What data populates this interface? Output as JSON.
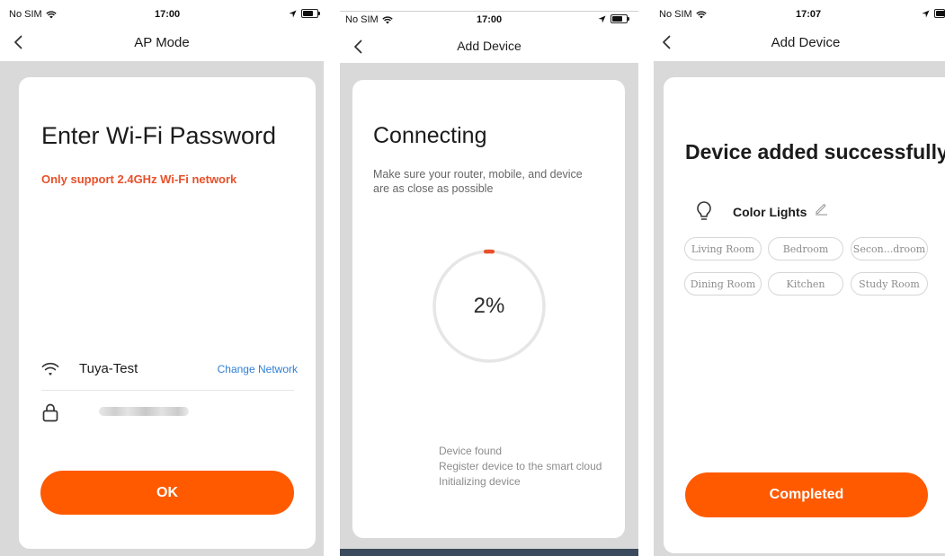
{
  "colors": {
    "accent": "#ff5a00",
    "warning_text": "#e8502a",
    "link": "#2e7fd6",
    "backdrop": "#d9d9d9"
  },
  "screen_ap_mode": {
    "status": {
      "carrier": "No SIM",
      "time": "17:00"
    },
    "nav": {
      "title": "AP Mode",
      "back_icon": "chevron-left-icon"
    },
    "heading": "Enter Wi-Fi Password",
    "warning": "Only support 2.4GHz Wi-Fi network",
    "wifi": {
      "icon": "wifi-icon",
      "ssid": "Tuya-Test",
      "change_label": "Change Network"
    },
    "password": {
      "icon": "lock-icon",
      "value": ""
    },
    "ok_label": "OK"
  },
  "screen_connecting": {
    "status": {
      "carrier": "No SIM",
      "time": "17:00"
    },
    "nav": {
      "title": "Add Device",
      "back_icon": "chevron-left-icon"
    },
    "heading": "Connecting",
    "subtitle": "Make sure your router, mobile, and device are as close as possible",
    "progress": {
      "percent": 2,
      "label": "2%"
    },
    "steps": [
      "Device found",
      "Register device to the smart cloud",
      "Initializing device"
    ]
  },
  "screen_success": {
    "status": {
      "carrier": "No SIM",
      "time": "17:07"
    },
    "nav": {
      "title": "Add Device",
      "back_icon": "chevron-left-icon"
    },
    "heading": "Device added successfully",
    "device": {
      "icon": "lightbulb-icon",
      "name": "Color Lights",
      "edit_icon": "pencil-icon"
    },
    "rooms": [
      "Living Room",
      "Bedroom",
      "Secon...droom",
      "Dining Room",
      "Kitchen",
      "Study Room"
    ],
    "completed_label": "Completed"
  }
}
